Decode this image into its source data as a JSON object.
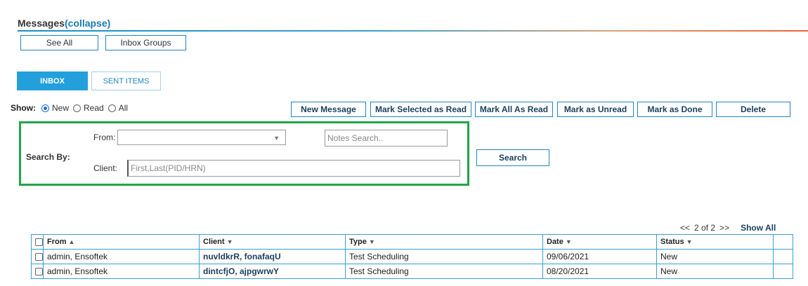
{
  "header": {
    "title": "Messages",
    "collapse_link": "(collapse)"
  },
  "top_buttons": {
    "see_all": "See All",
    "inbox_groups": "Inbox Groups"
  },
  "tabs": {
    "inbox": "INBOX",
    "sent_items": "SENT ITEMS"
  },
  "show": {
    "label": "Show:",
    "options": [
      "New",
      "Read",
      "All"
    ],
    "selected": "New"
  },
  "actions": {
    "new_message": "New Message",
    "mark_selected_read": "Mark Selected as Read",
    "mark_all_read": "Mark All As Read",
    "mark_unread": "Mark as Unread",
    "mark_done": "Mark as Done",
    "delete": "Delete"
  },
  "search": {
    "label": "Search By:",
    "from_label": "From:",
    "from_value": "",
    "notes_placeholder": "Notes Search..",
    "client_label": "Client:",
    "client_placeholder": "First,Last(PID/HRN)",
    "search_button": "Search"
  },
  "pager": {
    "prev": "<<",
    "page_text": "2 of 2",
    "next": ">>",
    "show_all": "Show All"
  },
  "table": {
    "columns": [
      "From",
      "Client",
      "Type",
      "Date",
      "Status"
    ],
    "rows": [
      {
        "from": "admin, Ensoftek",
        "client": "nuvldkrR, fonafaqU",
        "type": "Test Scheduling",
        "date": "09/06/2021",
        "status": "New"
      },
      {
        "from": "admin, Ensoftek",
        "client": "dintcfjO, ajpgwrwY",
        "type": "Test Scheduling",
        "date": "08/20/2021",
        "status": "New"
      }
    ]
  },
  "colors": {
    "accent": "#23a0db",
    "border": "#1f86c0",
    "search_outline": "#22a44a"
  }
}
